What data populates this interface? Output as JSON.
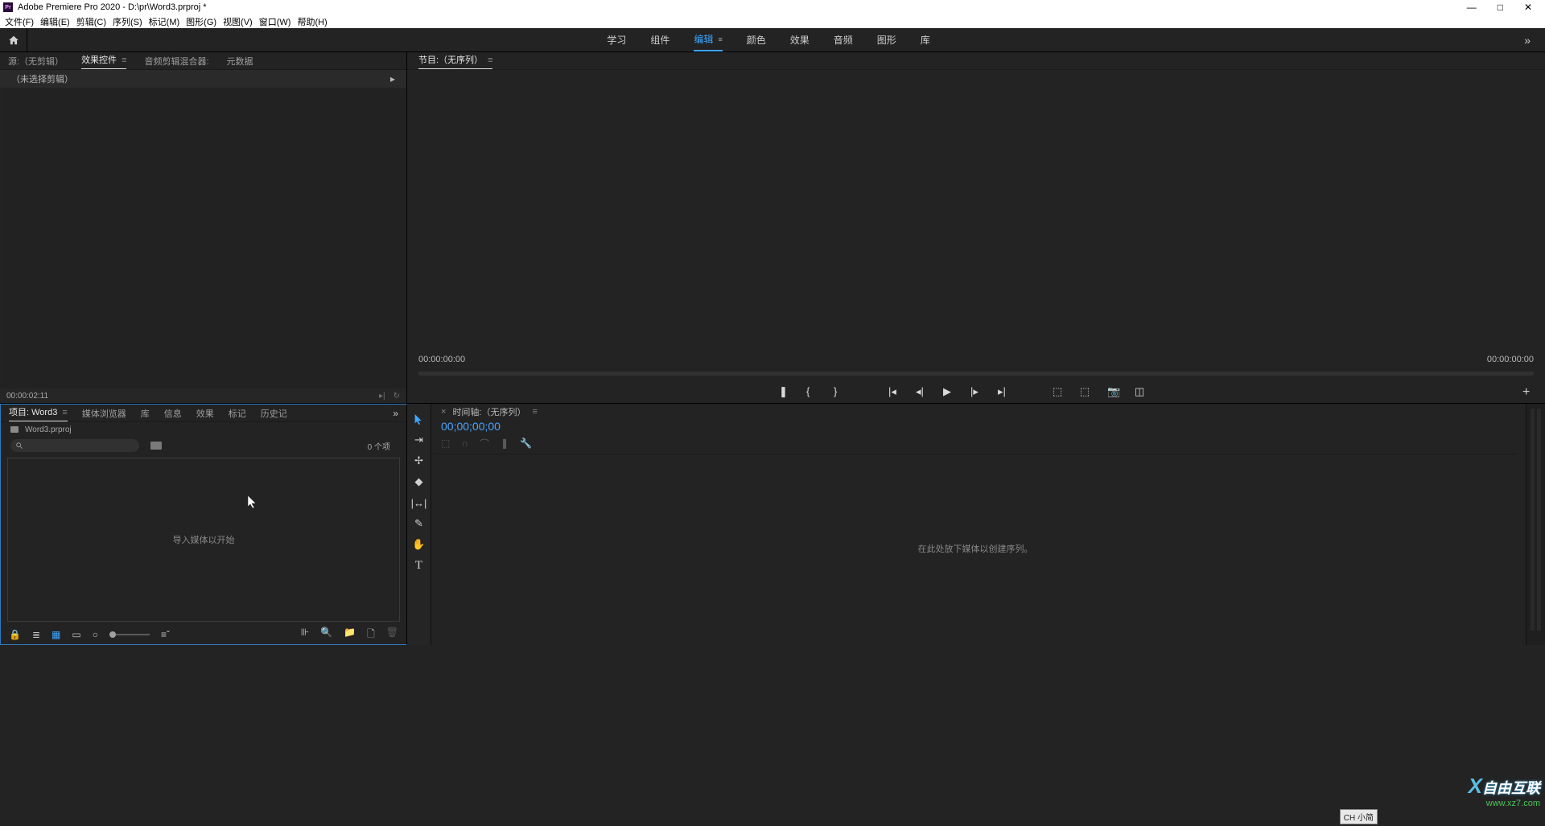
{
  "titlebar": {
    "app_icon_text": "Pr",
    "title": "Adobe Premiere Pro 2020 - D:\\pr\\Word3.prproj *"
  },
  "menubar": {
    "items": [
      "文件(F)",
      "编辑(E)",
      "剪辑(C)",
      "序列(S)",
      "标记(M)",
      "图形(G)",
      "视图(V)",
      "窗口(W)",
      "帮助(H)"
    ]
  },
  "workspaces": {
    "items": [
      {
        "label": "学习",
        "active": false
      },
      {
        "label": "组件",
        "active": false
      },
      {
        "label": "编辑",
        "active": true
      },
      {
        "label": "颜色",
        "active": false
      },
      {
        "label": "效果",
        "active": false
      },
      {
        "label": "音频",
        "active": false
      },
      {
        "label": "图形",
        "active": false
      },
      {
        "label": "库",
        "active": false
      }
    ],
    "overflow": "»"
  },
  "source_panel": {
    "tabs": [
      {
        "label": "源:（无剪辑）",
        "active": false
      },
      {
        "label": "效果控件",
        "active": true
      },
      {
        "label": "音频剪辑混合器:",
        "active": false
      },
      {
        "label": "元数据",
        "active": false
      }
    ],
    "subheader": "（未选择剪辑）",
    "footer_time": "00:00:02:11"
  },
  "program_panel": {
    "tab_label": "节目:（无序列）",
    "time_left": "00:00:00:00",
    "time_right": "00:00:00:00"
  },
  "project_panel": {
    "tabs": [
      {
        "label": "项目: Word3",
        "active": true
      },
      {
        "label": "媒体浏览器",
        "active": false
      },
      {
        "label": "库",
        "active": false
      },
      {
        "label": "信息",
        "active": false
      },
      {
        "label": "效果",
        "active": false
      },
      {
        "label": "标记",
        "active": false
      },
      {
        "label": "历史记",
        "active": false
      }
    ],
    "filename": "Word3.prproj",
    "item_count": "0 个项",
    "placeholder": "导入媒体以开始",
    "overflow": "»"
  },
  "timeline_panel": {
    "tab_label": "时间轴:（无序列）",
    "timecode": "00;00;00;00",
    "placeholder": "在此处放下媒体以创建序列。"
  },
  "tools": [
    "▸",
    "⇥",
    "✢",
    "◈",
    "|↔|",
    "✎",
    "✋",
    "T"
  ],
  "watermark": {
    "brand": "自由互联",
    "url": "www.xz7.com"
  },
  "ime": "CH 小简"
}
